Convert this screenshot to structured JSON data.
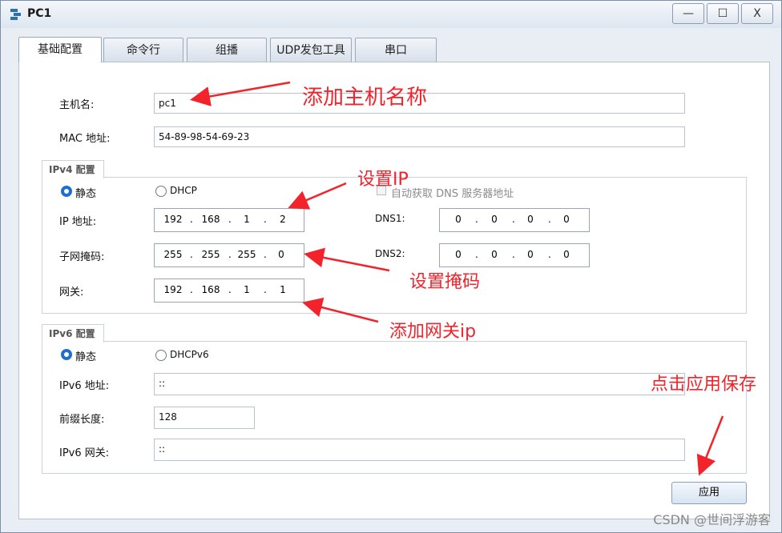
{
  "window": {
    "title": "PC1",
    "min": "—",
    "max": "☐",
    "close": "X"
  },
  "tabs": [
    "基础配置",
    "命令行",
    "组播",
    "UDP发包工具",
    "串口"
  ],
  "basic": {
    "hostname_label": "主机名:",
    "hostname_value": "pc1",
    "mac_label": "MAC 地址:",
    "mac_value": "54-89-98-54-69-23"
  },
  "ipv4": {
    "group_title": "IPv4 配置",
    "static_label": "静态",
    "dhcp_label": "DHCP",
    "auto_dns_label": "自动获取 DNS 服务器地址",
    "ip_label": "IP 地址:",
    "ip": [
      "192",
      "168",
      "1",
      "2"
    ],
    "mask_label": "子网掩码:",
    "mask": [
      "255",
      "255",
      "255",
      "0"
    ],
    "gw_label": "网关:",
    "gw": [
      "192",
      "168",
      "1",
      "1"
    ],
    "dns1_label": "DNS1:",
    "dns1": [
      "0",
      "0",
      "0",
      "0"
    ],
    "dns2_label": "DNS2:",
    "dns2": [
      "0",
      "0",
      "0",
      "0"
    ]
  },
  "ipv6": {
    "group_title": "IPv6 配置",
    "static_label": "静态",
    "dhcp_label": "DHCPv6",
    "addr_label": "IPv6 地址:",
    "addr_value": "::",
    "prefix_label": "前缀长度:",
    "prefix_value": "128",
    "gw_label": "IPv6 网关:",
    "gw_value": "::"
  },
  "apply_label": "应用",
  "annotations": {
    "hostname": "添加主机名称",
    "ip": "设置IP",
    "mask": "设置掩码",
    "gateway": "添加网关ip",
    "apply": "点击应用保存"
  },
  "watermark": "CSDN @世间浮游客",
  "colors": {
    "annotation": "#f2232a",
    "radio_selected": "#1f6fd0"
  }
}
